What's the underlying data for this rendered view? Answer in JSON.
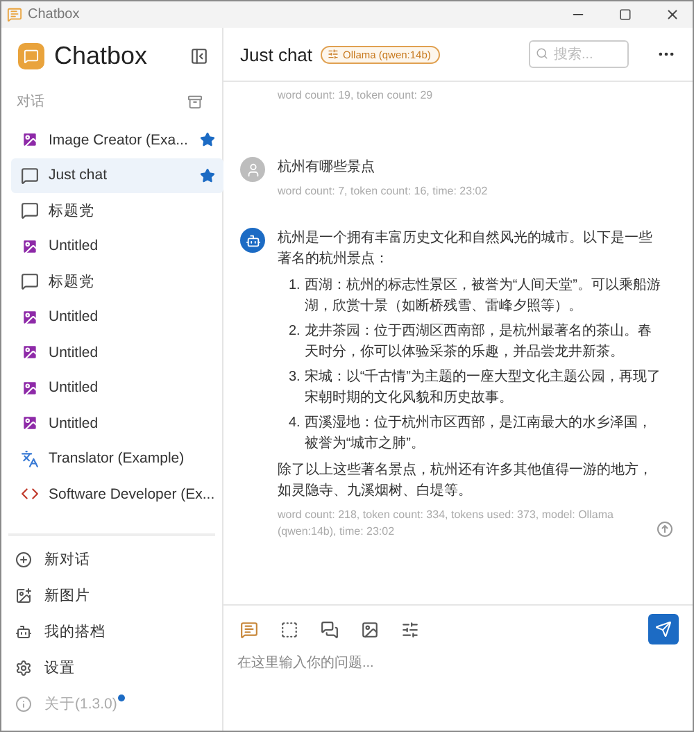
{
  "window": {
    "title": "Chatbox"
  },
  "sidebar": {
    "app_name": "Chatbox",
    "section_label": "对话",
    "items": [
      {
        "kind": "image",
        "label": "Image Creator (Exa...",
        "starred": true,
        "selected": false
      },
      {
        "kind": "chat",
        "label": "Just chat",
        "starred": true,
        "selected": true
      },
      {
        "kind": "chat",
        "label": "标题党",
        "starred": false,
        "selected": false
      },
      {
        "kind": "image",
        "label": "Untitled",
        "starred": false,
        "selected": false
      },
      {
        "kind": "chat",
        "label": "标题党",
        "starred": false,
        "selected": false
      },
      {
        "kind": "image",
        "label": "Untitled",
        "starred": false,
        "selected": false
      },
      {
        "kind": "image",
        "label": "Untitled",
        "starred": false,
        "selected": false
      },
      {
        "kind": "image",
        "label": "Untitled",
        "starred": false,
        "selected": false
      },
      {
        "kind": "image",
        "label": "Untitled",
        "starred": false,
        "selected": false
      },
      {
        "kind": "translator",
        "label": "Translator (Example)",
        "starred": false,
        "selected": false
      },
      {
        "kind": "developer",
        "label": "Software Developer (Ex...",
        "starred": false,
        "selected": false
      }
    ],
    "actions": [
      {
        "kind": "new-chat",
        "label": "新对话",
        "disabled": false,
        "dot": false
      },
      {
        "kind": "new-image",
        "label": "新图片",
        "disabled": false,
        "dot": false
      },
      {
        "kind": "partners",
        "label": "我的搭档",
        "disabled": false,
        "dot": false
      },
      {
        "kind": "settings",
        "label": "设置",
        "disabled": false,
        "dot": false
      },
      {
        "kind": "about",
        "label": "关于(1.3.0)",
        "disabled": true,
        "dot": true
      }
    ]
  },
  "header": {
    "title": "Just chat",
    "model_badge": "Ollama (qwen:14b)",
    "search": {
      "placeholder": "搜索..."
    }
  },
  "messages": [
    {
      "kind": "partial",
      "meta": "word count: 19, token count: 29"
    },
    {
      "kind": "user",
      "text": "杭州有哪些景点",
      "meta": "word count: 7, token count: 16, time: 23:02"
    },
    {
      "kind": "assistant",
      "text": "杭州是一个拥有丰富历史文化和自然风光的城市。以下是一些著名的杭州景点：",
      "list": [
        {
          "number": "1.",
          "text": "西湖：杭州的标志性景区，被誉为“人间天堂”。可以乘船游湖，欣赏十景（如断桥残雪、雷峰夕照等）。"
        },
        {
          "number": "2.",
          "text": "龙井茶园：位于西湖区西南部，是杭州最著名的茶山。春天时分，你可以体验采茶的乐趣，并品尝龙井新茶。"
        },
        {
          "number": "3.",
          "text": "宋城：以“千古情”为主题的一座大型文化主题公园，再现了宋朝时期的文化风貌和历史故事。"
        },
        {
          "number": "4.",
          "text": "西溪湿地：位于杭州市区西部，是江南最大的水乡泽国，被誉为“城市之肺”。"
        }
      ],
      "outro": "除了以上这些著名景点，杭州还有许多其他值得一游的地方，如灵隐寺、九溪烟树、白堤等。",
      "meta": "word count: 218, token count: 334, tokens used: 373, model: Ollama (qwen:14b), time: 23:02"
    }
  ],
  "input": {
    "placeholder": "在这里输入你的问题..."
  }
}
